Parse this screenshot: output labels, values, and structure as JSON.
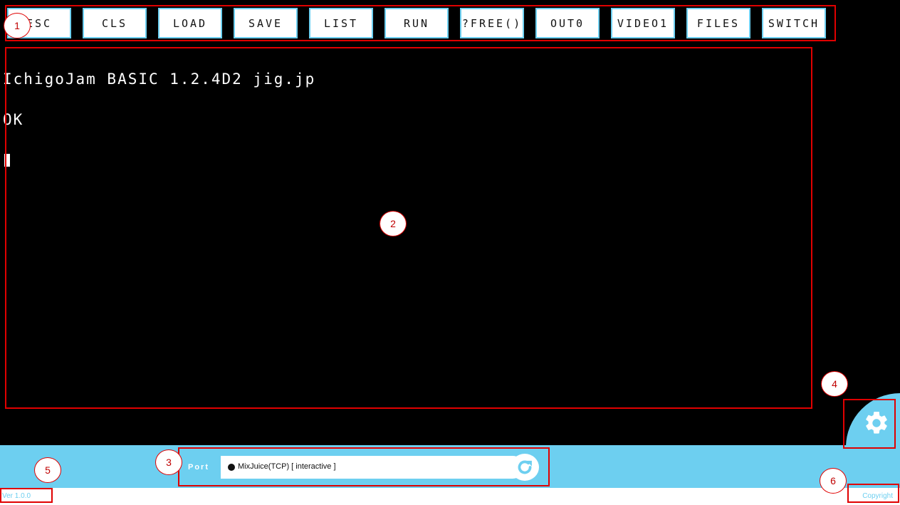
{
  "toolbar": {
    "buttons": [
      "ESC",
      "CLS",
      "LOAD",
      "SAVE",
      "LIST",
      "RUN",
      "?FREE()",
      "OUT0",
      "VIDEO1",
      "FILES",
      "SWITCH"
    ]
  },
  "terminal": {
    "lines": [
      "IchigoJam BASIC 1.2.4D2 jig.jp",
      "OK"
    ]
  },
  "port": {
    "label": "Port",
    "value": "MixJuice(TCP) [ interactive ]"
  },
  "footer": {
    "version": "Ver 1.0.0",
    "copyright": "Copyright"
  },
  "annotations": [
    "1",
    "2",
    "3",
    "4",
    "5",
    "6"
  ],
  "colors": {
    "accent": "#6dcff0",
    "screen": "#000000",
    "annotation": "#e00000"
  },
  "icons": {
    "settings": "gear-icon",
    "refresh": "refresh-icon"
  }
}
